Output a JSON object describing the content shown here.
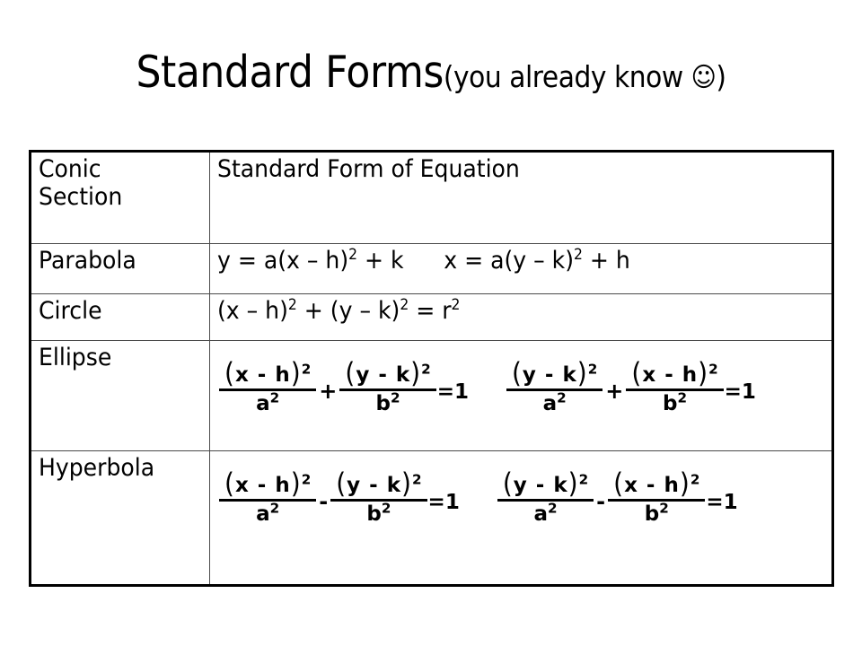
{
  "slide": {
    "title": {
      "main": "Standard Forms",
      "sub": "(you already know ",
      "smiley": "☺",
      "sub_close": ")"
    }
  },
  "table": {
    "headers": {
      "col1": "Conic\nSection",
      "col2": "Standard Form of Equation"
    },
    "rows": [
      {
        "label": "Parabola",
        "type": "text",
        "equation_1": "y = a(x – h)",
        "equation_1_sup": "2",
        "equation_1_tail": " + k",
        "equation_2": "x = a(y – k)",
        "equation_2_sup": "2",
        "equation_2_tail": " + h"
      },
      {
        "label": "Circle",
        "type": "text",
        "equation_1": "(x – h)",
        "equation_1_sup": "2",
        "equation_1_mid": " + (y – k)",
        "equation_1_sup2": "2",
        "equation_1_tail": " = r",
        "equation_1_sup3": "2"
      },
      {
        "label": "Ellipse",
        "type": "fraction",
        "eq1": {
          "f1_num_open": "(",
          "f1_num_body": "x  -  h",
          "f1_num_close": ")",
          "f1_num_sup": "2",
          "f1_den": "a",
          "f1_den_sup": "2",
          "operator": "+",
          "f2_num_open": "(",
          "f2_num_body": "y  -  k",
          "f2_num_close": ")",
          "f2_num_sup": "2",
          "f2_den": "b",
          "f2_den_sup": "2",
          "result": "=1"
        },
        "eq2": {
          "f1_num_open": "(",
          "f1_num_body": "y  -  k",
          "f1_num_close": ")",
          "f1_num_sup": "2",
          "f1_den": "a",
          "f1_den_sup": "2",
          "operator": "+",
          "f2_num_open": "(",
          "f2_num_body": "x  -  h",
          "f2_num_close": ")",
          "f2_num_sup": "2",
          "f2_den": "b",
          "f2_den_sup": "2",
          "result": "=1"
        }
      },
      {
        "label": "Hyperbola",
        "type": "fraction",
        "eq1": {
          "f1_num_open": "(",
          "f1_num_body": "x  -  h",
          "f1_num_close": ")",
          "f1_num_sup": "2",
          "f1_den": "a",
          "f1_den_sup": "2",
          "operator": "-",
          "f2_num_open": "(",
          "f2_num_body": "y  -  k",
          "f2_num_close": ")",
          "f2_num_sup": "2",
          "f2_den": "b",
          "f2_den_sup": "2",
          "result": "=1"
        },
        "eq2": {
          "f1_num_open": "(",
          "f1_num_body": "y  -  k",
          "f1_num_close": ")",
          "f1_num_sup": "2",
          "f1_den": "a",
          "f1_den_sup": "2",
          "operator": "-",
          "f2_num_open": "(",
          "f2_num_body": "x  -  h",
          "f2_num_close": ")",
          "f2_num_sup": "2",
          "f2_den": "b",
          "f2_den_sup": "2",
          "result": "=1"
        }
      }
    ]
  },
  "colors": {
    "background": "#ffffff",
    "text": "#000000",
    "table_outer_border": "#000000",
    "table_inner_border": "#4a4a4a"
  }
}
